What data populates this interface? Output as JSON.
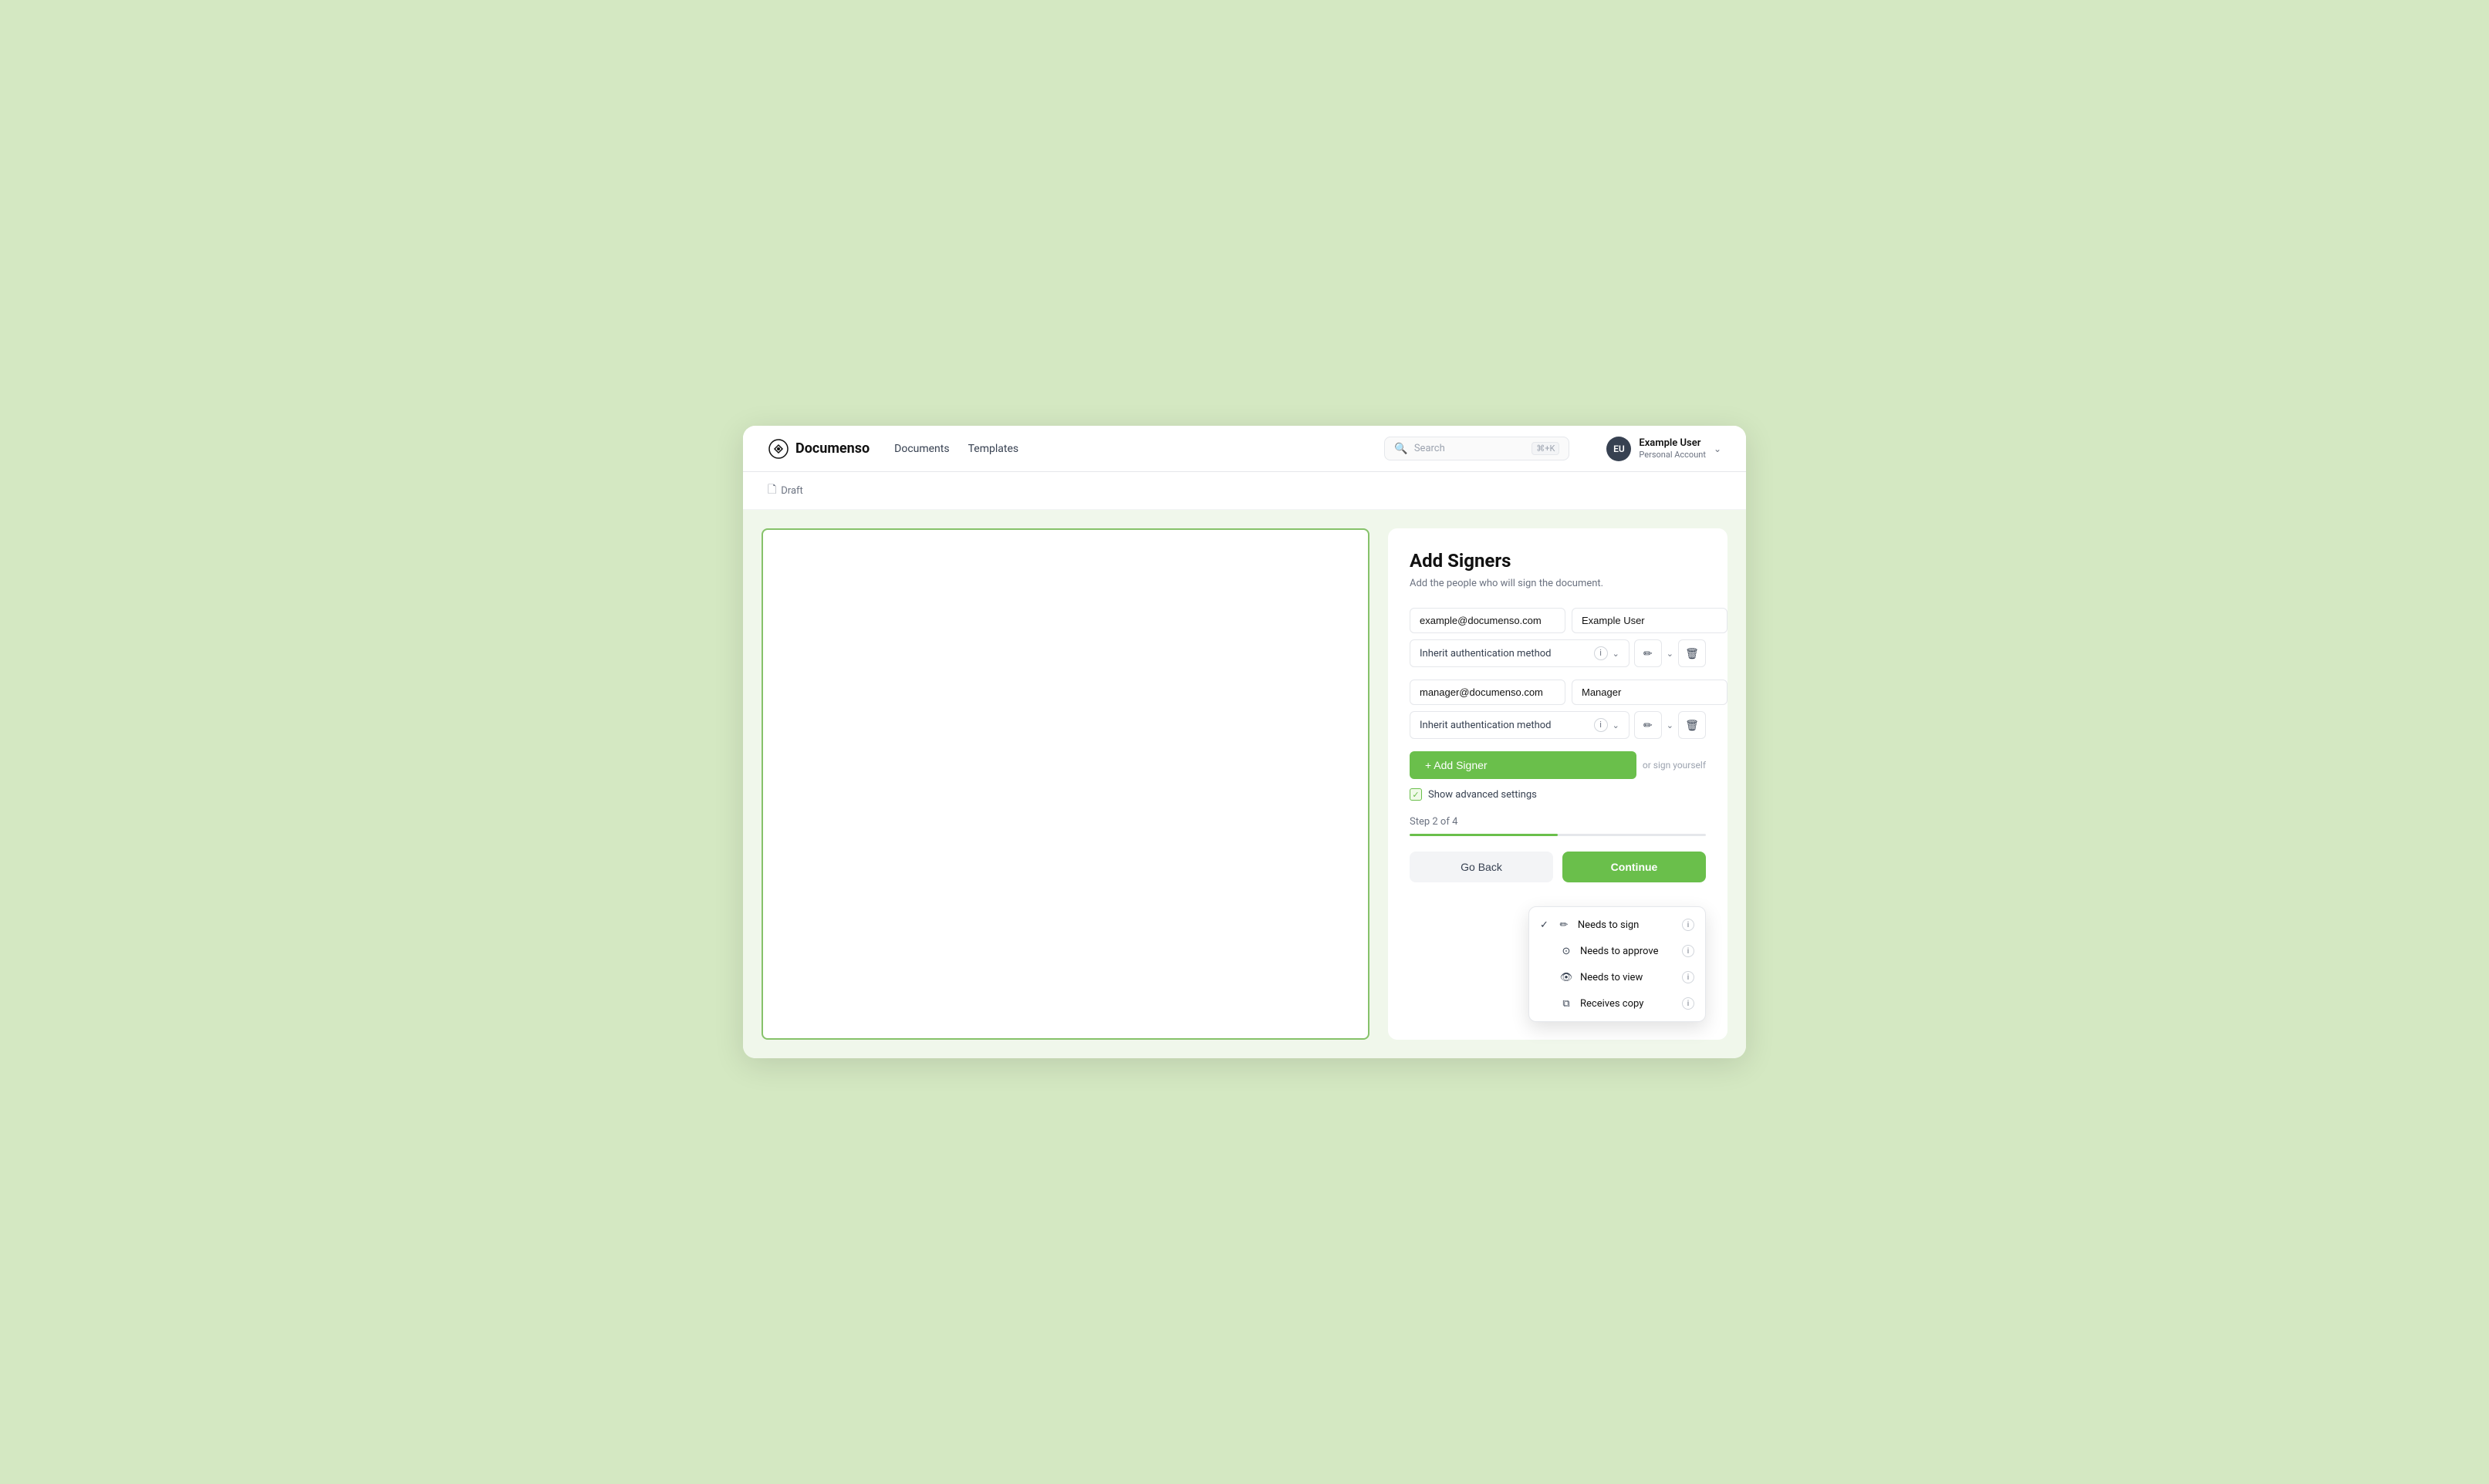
{
  "app": {
    "name": "Documenso"
  },
  "nav": {
    "documents_label": "Documents",
    "templates_label": "Templates"
  },
  "search": {
    "placeholder": "Search",
    "shortcut": "⌘+K"
  },
  "user": {
    "initials": "EU",
    "name": "Example User",
    "account": "Personal Account"
  },
  "breadcrumb": {
    "label": "Draft"
  },
  "panel": {
    "title": "Add Signers",
    "subtitle": "Add the people who will sign the document.",
    "signer1": {
      "email": "example@documenso.com",
      "name": "Example User",
      "auth_method": "Inherit authentication method"
    },
    "signer2": {
      "email": "manager@documenso.com",
      "name": "Manager",
      "auth_method": "Inherit authentication method"
    },
    "add_signer_label": "+ Add Signer",
    "self_sign_label": "or sign yourself",
    "advanced_settings_label": "Show advanced settings",
    "step_label": "Step 2 of 4",
    "go_back_label": "Go Back",
    "continue_label": "Continue"
  },
  "dropdown": {
    "items": [
      {
        "id": "needs-to-sign",
        "label": "Needs to sign",
        "checked": true
      },
      {
        "id": "needs-to-approve",
        "label": "Needs to approve",
        "checked": false
      },
      {
        "id": "needs-to-view",
        "label": "Needs to view",
        "checked": false
      },
      {
        "id": "receives-copy",
        "label": "Receives copy",
        "checked": false
      }
    ]
  }
}
